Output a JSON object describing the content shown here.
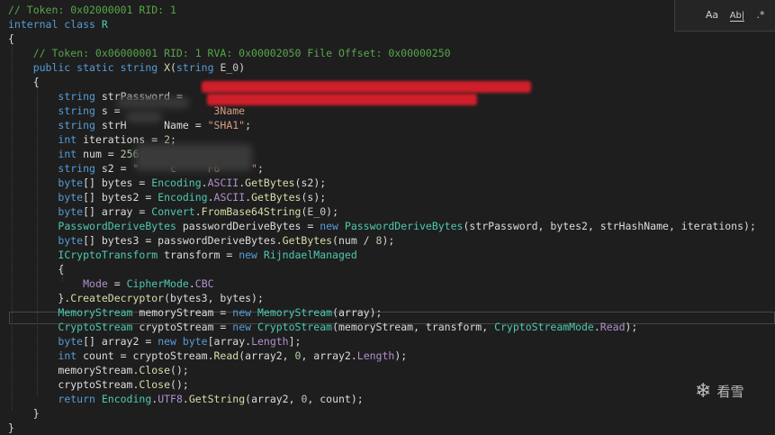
{
  "code": {
    "lines": [
      [
        [
          "// Token: 0x02000001 RID: 1",
          "c"
        ]
      ],
      [
        [
          "internal class ",
          "k"
        ],
        [
          "R",
          "t"
        ]
      ],
      [
        [
          "{",
          ""
        ]
      ],
      [
        [
          "    // Token: 0x06000001 RID: 1 RVA: 0x00002050 File Offset: 0x00000250",
          "c"
        ]
      ],
      [
        [
          "    public static string ",
          "k"
        ],
        [
          "X",
          "m"
        ],
        [
          "(",
          ""
        ],
        [
          "string ",
          "k"
        ],
        [
          "E_0",
          "e"
        ],
        [
          ")",
          ""
        ]
      ],
      [
        [
          "    {",
          ""
        ]
      ],
      [
        [
          "        ",
          ""
        ],
        [
          "string ",
          "k"
        ],
        [
          "strPassword = ",
          ""
        ]
      ],
      [
        [
          "        ",
          ""
        ],
        [
          "string ",
          "k"
        ],
        [
          "s = ",
          ""
        ],
        [
          "              3Name",
          "s"
        ]
      ],
      [
        [
          "        ",
          ""
        ],
        [
          "string ",
          "k"
        ],
        [
          "strH      Name = ",
          ""
        ],
        [
          "\"SHA1\"",
          "s"
        ],
        [
          ";",
          ""
        ]
      ],
      [
        [
          "        ",
          ""
        ],
        [
          "int ",
          "k"
        ],
        [
          "iterations = ",
          ""
        ],
        [
          "2",
          "n"
        ],
        [
          ";",
          ""
        ]
      ],
      [
        [
          "        ",
          ""
        ],
        [
          "int ",
          "k"
        ],
        [
          "num = ",
          ""
        ],
        [
          "256",
          "n"
        ],
        [
          ";",
          ""
        ]
      ],
      [
        [
          "        ",
          ""
        ],
        [
          "string ",
          "k"
        ],
        [
          "s2 = ",
          ""
        ],
        [
          "\"     c     F6     \"",
          "s"
        ],
        [
          ";",
          ""
        ]
      ],
      [
        [
          "        ",
          ""
        ],
        [
          "byte",
          "k"
        ],
        [
          "[] bytes = ",
          ""
        ],
        [
          "Encoding",
          "t"
        ],
        [
          ".",
          ""
        ],
        [
          "ASCII",
          "p"
        ],
        [
          ".",
          ""
        ],
        [
          "GetBytes",
          "m"
        ],
        [
          "(s2);",
          ""
        ]
      ],
      [
        [
          "        ",
          ""
        ],
        [
          "byte",
          "k"
        ],
        [
          "[] bytes2 = ",
          ""
        ],
        [
          "Encoding",
          "t"
        ],
        [
          ".",
          ""
        ],
        [
          "ASCII",
          "p"
        ],
        [
          ".",
          ""
        ],
        [
          "GetBytes",
          "m"
        ],
        [
          "(s);",
          ""
        ]
      ],
      [
        [
          "        ",
          ""
        ],
        [
          "byte",
          "k"
        ],
        [
          "[] array = ",
          ""
        ],
        [
          "Convert",
          "t"
        ],
        [
          ".",
          ""
        ],
        [
          "FromBase64String",
          "m"
        ],
        [
          "(",
          ""
        ],
        [
          "E_0",
          "e"
        ],
        [
          ");",
          ""
        ]
      ],
      [
        [
          "        ",
          ""
        ],
        [
          "PasswordDeriveBytes",
          "t"
        ],
        [
          " passwordDeriveBytes = ",
          ""
        ],
        [
          "new ",
          "k"
        ],
        [
          "PasswordDeriveBytes",
          "t"
        ],
        [
          "(strPassword, bytes2, strHashName, iterations);",
          ""
        ]
      ],
      [
        [
          "        ",
          ""
        ],
        [
          "byte",
          "k"
        ],
        [
          "[] bytes3 = passwordDeriveBytes.",
          ""
        ],
        [
          "GetBytes",
          "m"
        ],
        [
          "(num / ",
          ""
        ],
        [
          "8",
          "n"
        ],
        [
          ");",
          ""
        ]
      ],
      [
        [
          "        ",
          ""
        ],
        [
          "ICryptoTransform",
          "t"
        ],
        [
          " transform = ",
          ""
        ],
        [
          "new ",
          "k"
        ],
        [
          "RijndaelManaged",
          "t"
        ]
      ],
      [
        [
          "        {",
          ""
        ]
      ],
      [
        [
          "            ",
          ""
        ],
        [
          "Mode",
          "p"
        ],
        [
          " = ",
          ""
        ],
        [
          "CipherMode",
          "t"
        ],
        [
          ".",
          ""
        ],
        [
          "CBC",
          "p"
        ]
      ],
      [
        [
          "        }.",
          ""
        ],
        [
          "CreateDecryptor",
          "m"
        ],
        [
          "(bytes3, bytes);",
          ""
        ]
      ],
      [
        [
          "        ",
          ""
        ],
        [
          "MemoryStream",
          "t"
        ],
        [
          " memoryStream = ",
          ""
        ],
        [
          "new ",
          "k"
        ],
        [
          "MemoryStream",
          "t"
        ],
        [
          "(array);",
          ""
        ]
      ],
      [
        [
          "        ",
          ""
        ],
        [
          "CryptoStream",
          "t"
        ],
        [
          " cryptoStream = ",
          ""
        ],
        [
          "new ",
          "k"
        ],
        [
          "CryptoStream",
          "t"
        ],
        [
          "(memoryStream, transform, ",
          ""
        ],
        [
          "CryptoStreamMode",
          "t"
        ],
        [
          ".",
          ""
        ],
        [
          "Read",
          "p"
        ],
        [
          ");",
          ""
        ]
      ],
      [
        [
          "        ",
          ""
        ],
        [
          "byte",
          "k"
        ],
        [
          "[] array2 = ",
          ""
        ],
        [
          "new ",
          "k"
        ],
        [
          "byte",
          "k"
        ],
        [
          "[array.",
          ""
        ],
        [
          "Length",
          "p"
        ],
        [
          "];",
          ""
        ]
      ],
      [
        [
          "        ",
          ""
        ],
        [
          "int ",
          "k"
        ],
        [
          "count = cryptoStream.",
          ""
        ],
        [
          "Read",
          "m"
        ],
        [
          "(array2, ",
          ""
        ],
        [
          "0",
          "n"
        ],
        [
          ", array2.",
          ""
        ],
        [
          "Length",
          "p"
        ],
        [
          ");",
          ""
        ]
      ],
      [
        [
          "        memoryStream.",
          ""
        ],
        [
          "Close",
          "m"
        ],
        [
          "();",
          ""
        ]
      ],
      [
        [
          "        cryptoStream.",
          ""
        ],
        [
          "Close",
          "m"
        ],
        [
          "();",
          ""
        ]
      ],
      [
        [
          "        ",
          ""
        ],
        [
          "return ",
          "k"
        ],
        [
          "Encoding",
          "t"
        ],
        [
          ".",
          ""
        ],
        [
          "UTF8",
          "p"
        ],
        [
          ".",
          ""
        ],
        [
          "GetString",
          "m"
        ],
        [
          "(array2, ",
          ""
        ],
        [
          "0",
          "n"
        ],
        [
          ", count);",
          ""
        ]
      ],
      [
        [
          "    }",
          ""
        ]
      ],
      [
        [
          "}",
          ""
        ]
      ]
    ]
  },
  "findbar": {
    "match_case_label": "Aa",
    "whole_word_label": "Ab|",
    "regex_label": ".*"
  },
  "watermark": {
    "text": "看雪"
  }
}
